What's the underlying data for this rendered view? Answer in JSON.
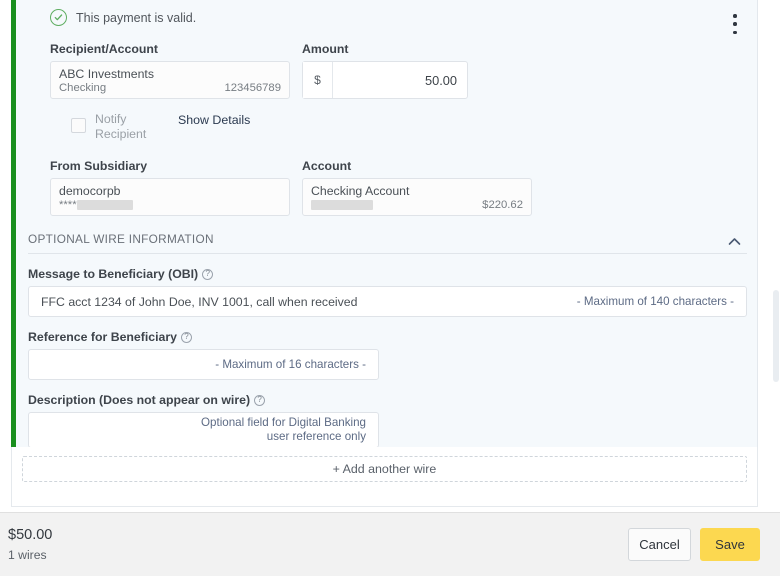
{
  "status": {
    "icon": "check-circle-icon",
    "message": "This payment is valid.",
    "color": "#1a8f1e"
  },
  "menu": {
    "icon": "kebab-menu-icon"
  },
  "recipient": {
    "label": "Recipient/Account",
    "name": "ABC Investments",
    "account_type": "Checking",
    "account_number": "123456789"
  },
  "amount": {
    "label": "Amount",
    "currency_symbol": "$",
    "value": "50.00"
  },
  "notify": {
    "label": "Notify Recipient",
    "checked": false,
    "show_details_label": "Show Details"
  },
  "subsidiary": {
    "label": "From Subsidiary",
    "name": "democorpb",
    "masked_prefix": "****",
    "redacted": true
  },
  "account": {
    "label": "Account",
    "name": "Checking Account",
    "redacted": true,
    "balance": "$220.62"
  },
  "optional_section": {
    "title": "OPTIONAL WIRE INFORMATION",
    "collapse_icon": "chevron-up-icon",
    "expanded": true
  },
  "fields": {
    "obi": {
      "label": "Message to Beneficiary (OBI)",
      "help_icon": "question-circle-icon",
      "value": "FFC acct 1234 of John Doe, INV 1001, call when received",
      "hint": "- Maximum of 140 characters -"
    },
    "reference": {
      "label": "Reference for Beneficiary",
      "help_icon": "question-circle-icon",
      "value": "",
      "hint": "- Maximum of 16 characters -"
    },
    "description": {
      "label": "Description (Does not appear on wire)",
      "help_icon": "question-circle-icon",
      "value": "",
      "hint_line1": "Optional field for Digital Banking",
      "hint_line2": "user reference only"
    }
  },
  "add_wire": {
    "label": "+ Add another wire"
  },
  "footer": {
    "total_amount": "$50.00",
    "wire_count": "1 wires",
    "cancel_label": "Cancel",
    "save_label": "Save",
    "save_color": "#fcd850"
  }
}
